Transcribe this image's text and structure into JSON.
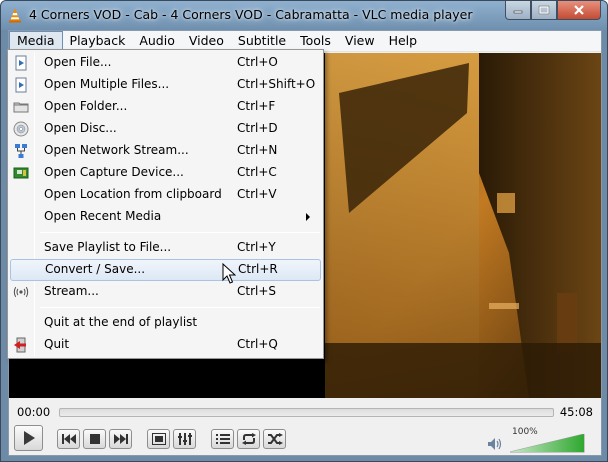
{
  "window": {
    "title": "4 Corners VOD - Cab - 4 Corners VOD - Cabramatta - VLC media player",
    "app_icon": "vlc-cone-icon"
  },
  "menubar": {
    "items": [
      {
        "label": "Media",
        "active": true
      },
      {
        "label": "Playback"
      },
      {
        "label": "Audio"
      },
      {
        "label": "Video"
      },
      {
        "label": "Subtitle"
      },
      {
        "label": "Tools"
      },
      {
        "label": "View"
      },
      {
        "label": "Help"
      }
    ]
  },
  "media_menu": {
    "items": [
      {
        "label": "Open File...",
        "shortcut": "Ctrl+O",
        "icon": "open-file-icon"
      },
      {
        "label": "Open Multiple Files...",
        "shortcut": "Ctrl+Shift+O",
        "icon": "open-multiple-files-icon"
      },
      {
        "label": "Open Folder...",
        "shortcut": "Ctrl+F",
        "icon": "folder-icon"
      },
      {
        "label": "Open Disc...",
        "shortcut": "Ctrl+D",
        "icon": "disc-icon"
      },
      {
        "label": "Open Network Stream...",
        "shortcut": "Ctrl+N",
        "icon": "network-icon"
      },
      {
        "label": "Open Capture Device...",
        "shortcut": "Ctrl+C",
        "icon": "capture-card-icon"
      },
      {
        "label": "Open Location from clipboard",
        "shortcut": "Ctrl+V"
      },
      {
        "label": "Open Recent Media",
        "shortcut": "",
        "submenu": true
      },
      {
        "label": "Save Playlist to File...",
        "shortcut": "Ctrl+Y"
      },
      {
        "label": "Convert / Save...",
        "shortcut": "Ctrl+R",
        "highlighted": true
      },
      {
        "label": "Stream...",
        "shortcut": "Ctrl+S",
        "icon": "stream-icon"
      },
      {
        "label": "Quit at the end of playlist",
        "shortcut": ""
      },
      {
        "label": "Quit",
        "shortcut": "Ctrl+Q",
        "icon": "quit-icon"
      }
    ]
  },
  "player": {
    "time_current": "00:00",
    "time_total": "45:08",
    "seek_fraction": 0,
    "volume_label": "100%",
    "volume_fraction": 1.0
  },
  "controls": {
    "buttons": [
      {
        "name": "play-button",
        "icon": "play-icon"
      },
      {
        "name": "previous-button",
        "icon": "previous-icon"
      },
      {
        "name": "stop-button",
        "icon": "stop-icon"
      },
      {
        "name": "next-button",
        "icon": "next-icon"
      },
      {
        "name": "fullscreen-button",
        "icon": "fullscreen-icon"
      },
      {
        "name": "extended-settings-button",
        "icon": "equalizer-icon"
      },
      {
        "name": "playlist-button",
        "icon": "playlist-icon"
      },
      {
        "name": "loop-button",
        "icon": "loop-icon"
      },
      {
        "name": "random-button",
        "icon": "shuffle-icon"
      }
    ]
  },
  "colors": {
    "menu_highlight_border": "#a8c4e2",
    "volume_green": "#3cb43c"
  }
}
